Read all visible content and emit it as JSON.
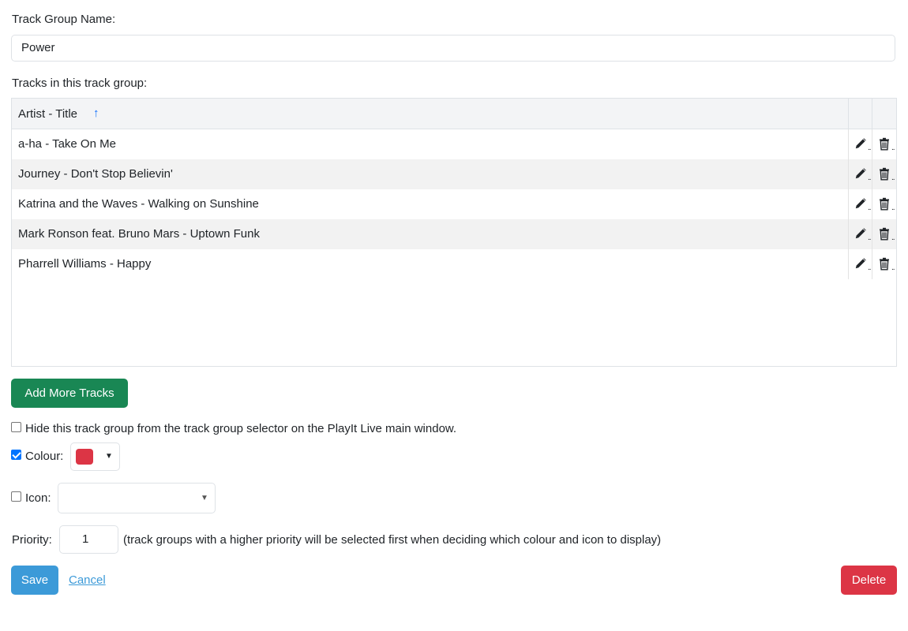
{
  "form": {
    "name_label": "Track Group Name:",
    "name_value": "Power",
    "tracks_label": "Tracks in this track group:"
  },
  "table": {
    "column_header": "Artist - Title",
    "sort_icon": "arrow-up-icon",
    "rows": [
      {
        "label": "a-ha - Take On Me"
      },
      {
        "label": "Journey - Don't Stop Believin'"
      },
      {
        "label": "Katrina and the Waves - Walking on Sunshine"
      },
      {
        "label": "Mark Ronson feat. Bruno Mars - Uptown Funk"
      },
      {
        "label": "Pharrell Williams - Happy"
      }
    ],
    "row_actions": [
      "pencil-icon",
      "trash-icon"
    ]
  },
  "buttons": {
    "add_tracks": "Add More Tracks",
    "save": "Save",
    "cancel": "Cancel",
    "delete": "Delete"
  },
  "options": {
    "hide_label": "Hide this track group from the track group selector on the PlayIt Live main window.",
    "hide_checked": false,
    "colour_label": "Colour:",
    "colour_checked": true,
    "colour_value": "#dc3545",
    "icon_label": "Icon:",
    "icon_checked": false,
    "icon_value": "",
    "priority_label": "Priority:",
    "priority_value": "1",
    "priority_hint": "(track groups with a higher priority will be selected first when deciding which colour and icon to display)"
  },
  "colors": {
    "add_button": "#198754",
    "save_button": "#3c9ad8",
    "delete_button": "#dc3545",
    "sort_arrow": "#0d6efd"
  }
}
